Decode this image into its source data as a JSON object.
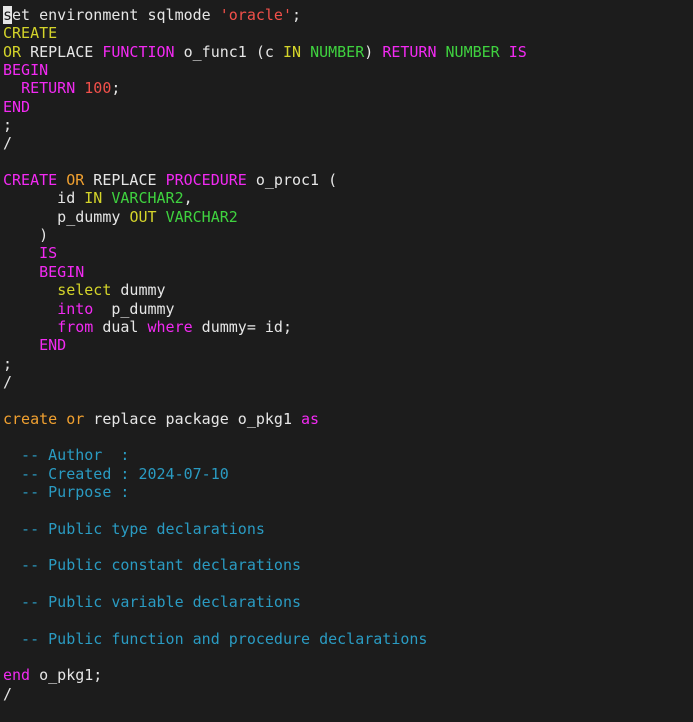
{
  "editor": {
    "colors": {
      "background": "#1c1c1c",
      "text": "#e6e6e6",
      "keyword_pink": "#f22af2",
      "keyword_yellow": "#d4d42a",
      "keyword_orange": "#f0a030",
      "type_green": "#3fd23f",
      "literal_red": "#f2504a",
      "comment_blue": "#2a9bc2"
    },
    "lines": [
      [
        {
          "t": "s",
          "c": "cursor"
        },
        {
          "t": "et environment sqlmode ",
          "c": "ident"
        },
        {
          "t": "'oracle'",
          "c": "str"
        },
        {
          "t": ";",
          "c": "ident"
        }
      ],
      [
        {
          "t": "CREATE",
          "c": "kw-yellow"
        }
      ],
      [
        {
          "t": "OR",
          "c": "kw-yellow"
        },
        {
          "t": " REPLACE ",
          "c": "ident"
        },
        {
          "t": "FUNCTION",
          "c": "kw-pink"
        },
        {
          "t": " o_func1 (c ",
          "c": "ident"
        },
        {
          "t": "IN",
          "c": "kw-yellow"
        },
        {
          "t": " ",
          "c": "ident"
        },
        {
          "t": "NUMBER",
          "c": "type-green"
        },
        {
          "t": ") ",
          "c": "ident"
        },
        {
          "t": "RETURN",
          "c": "kw-pink"
        },
        {
          "t": " ",
          "c": "ident"
        },
        {
          "t": "NUMBER",
          "c": "type-green"
        },
        {
          "t": " ",
          "c": "ident"
        },
        {
          "t": "IS",
          "c": "kw-pink"
        }
      ],
      [
        {
          "t": "BEGIN",
          "c": "kw-pink"
        }
      ],
      [
        {
          "t": "  ",
          "c": "ident"
        },
        {
          "t": "RETURN",
          "c": "kw-pink"
        },
        {
          "t": " ",
          "c": "ident"
        },
        {
          "t": "100",
          "c": "num"
        },
        {
          "t": ";",
          "c": "ident"
        }
      ],
      [
        {
          "t": "END",
          "c": "kw-pink"
        }
      ],
      [
        {
          "t": ";",
          "c": "ident"
        }
      ],
      [
        {
          "t": "/",
          "c": "ident"
        }
      ],
      [],
      [
        {
          "t": "CREATE",
          "c": "kw-pink"
        },
        {
          "t": " ",
          "c": "ident"
        },
        {
          "t": "OR",
          "c": "kw-orange"
        },
        {
          "t": " REPLACE ",
          "c": "ident"
        },
        {
          "t": "PROCEDURE",
          "c": "kw-pink"
        },
        {
          "t": " o_proc1 (",
          "c": "ident"
        }
      ],
      [
        {
          "t": "      id ",
          "c": "ident"
        },
        {
          "t": "IN",
          "c": "kw-yellow"
        },
        {
          "t": " ",
          "c": "ident"
        },
        {
          "t": "VARCHAR2",
          "c": "type-green"
        },
        {
          "t": ",",
          "c": "ident"
        }
      ],
      [
        {
          "t": "      p_dummy ",
          "c": "ident"
        },
        {
          "t": "OUT",
          "c": "kw-yellow"
        },
        {
          "t": " ",
          "c": "ident"
        },
        {
          "t": "VARCHAR2",
          "c": "type-green"
        }
      ],
      [
        {
          "t": "    )",
          "c": "ident"
        }
      ],
      [
        {
          "t": "    ",
          "c": "ident"
        },
        {
          "t": "IS",
          "c": "kw-pink"
        }
      ],
      [
        {
          "t": "    ",
          "c": "ident"
        },
        {
          "t": "BEGIN",
          "c": "kw-pink"
        }
      ],
      [
        {
          "t": "      ",
          "c": "ident"
        },
        {
          "t": "select",
          "c": "kw-yellow"
        },
        {
          "t": " dummy",
          "c": "ident"
        }
      ],
      [
        {
          "t": "      ",
          "c": "ident"
        },
        {
          "t": "into",
          "c": "kw-pink"
        },
        {
          "t": "  p_dummy",
          "c": "ident"
        }
      ],
      [
        {
          "t": "      ",
          "c": "ident"
        },
        {
          "t": "from",
          "c": "kw-pink"
        },
        {
          "t": " dual ",
          "c": "ident"
        },
        {
          "t": "where",
          "c": "kw-pink"
        },
        {
          "t": " dummy= id;",
          "c": "ident"
        }
      ],
      [
        {
          "t": "    ",
          "c": "ident"
        },
        {
          "t": "END",
          "c": "kw-pink"
        }
      ],
      [
        {
          "t": ";",
          "c": "ident"
        }
      ],
      [
        {
          "t": "/",
          "c": "ident"
        }
      ],
      [],
      [
        {
          "t": "create",
          "c": "kw-orange"
        },
        {
          "t": " ",
          "c": "ident"
        },
        {
          "t": "or",
          "c": "kw-orange"
        },
        {
          "t": " replace package o_pkg1 ",
          "c": "ident"
        },
        {
          "t": "as",
          "c": "kw-pink"
        }
      ],
      [],
      [
        {
          "t": "  -- Author  :",
          "c": "comment"
        }
      ],
      [
        {
          "t": "  -- Created : 2024-07-10",
          "c": "comment"
        }
      ],
      [
        {
          "t": "  -- Purpose :",
          "c": "comment"
        }
      ],
      [],
      [
        {
          "t": "  -- Public type declarations",
          "c": "comment"
        }
      ],
      [],
      [
        {
          "t": "  -- Public constant declarations",
          "c": "comment"
        }
      ],
      [],
      [
        {
          "t": "  -- Public variable declarations",
          "c": "comment"
        }
      ],
      [],
      [
        {
          "t": "  -- Public function and procedure declarations",
          "c": "comment"
        }
      ],
      [],
      [
        {
          "t": "end",
          "c": "kw-pink"
        },
        {
          "t": " o_pkg1;",
          "c": "ident"
        }
      ],
      [
        {
          "t": "/",
          "c": "ident"
        }
      ]
    ]
  }
}
